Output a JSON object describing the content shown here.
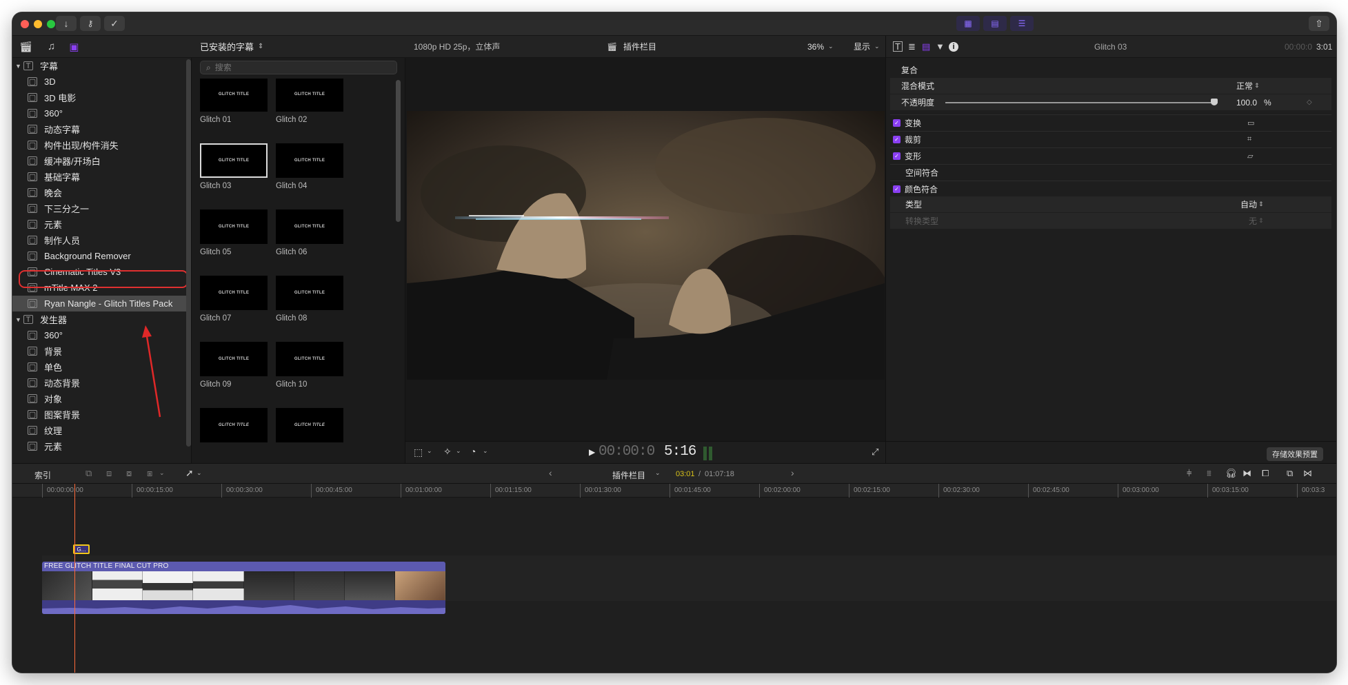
{
  "app": {
    "top_toolbar": {
      "import_icon": "arrow-down-icon",
      "keyword_icon": "key-icon",
      "check_icon": "checkmark-icon"
    }
  },
  "sidebar": {
    "groups": [
      {
        "label": "字幕",
        "items": [
          "3D",
          "3D 电影",
          "360°",
          "动态字幕",
          "构件出现/构件消失",
          "缓冲器/开场白",
          "基础字幕",
          "晚会",
          "下三分之一",
          "元素",
          "制作人员",
          "Background Remover",
          "Cinematic Titles V3",
          "mTitle MAX 2",
          "Ryan Nangle - Glitch Titles Pack"
        ]
      },
      {
        "label": "发生器",
        "items": [
          "360°",
          "背景",
          "单色",
          "动态背景",
          "对象",
          "图案背景",
          "纹理",
          "元素"
        ]
      }
    ],
    "selected": "Ryan Nangle - Glitch Titles Pack"
  },
  "browser": {
    "header": "已安装的字幕",
    "search_placeholder": "搜索",
    "thumb_caption": "GLITCH TITLE",
    "items": [
      "Glitch 01",
      "Glitch 02",
      "Glitch 03",
      "Glitch 04",
      "Glitch 05",
      "Glitch 06",
      "Glitch 07",
      "Glitch 08",
      "Glitch 09",
      "Glitch 10"
    ],
    "selected": "Glitch 03"
  },
  "viewer": {
    "format": "1080p HD 25p，立体声",
    "project": "插件栏目",
    "zoom": "36%",
    "display": "显示",
    "timecode_dim": "00:00:0",
    "timecode_bright": "5:16"
  },
  "inspector": {
    "title": "Glitch 03",
    "timecode_dim": "00:00:0",
    "timecode_bright": "3:01",
    "compositing": "复合",
    "blend_mode_label": "混合模式",
    "blend_mode_value": "正常",
    "opacity_label": "不透明度",
    "opacity_value": "100.0",
    "opacity_unit": "%",
    "opacity_fraction": 1.0,
    "transform": "变换",
    "crop": "裁剪",
    "distort": "变形",
    "spatial_conform": "空间符合",
    "color_conform": "颜色符合",
    "type_label": "类型",
    "type_value": "自动",
    "conversion_label": "转换类型",
    "conversion_value": "无",
    "save_preset": "存储效果预置"
  },
  "timeline": {
    "index": "索引",
    "project": "插件栏目",
    "position": "03:01",
    "duration": "01:07:18",
    "ruler": [
      "00:00:00:00",
      "00:00:15:00",
      "00:00:30:00",
      "00:00:45:00",
      "00:01:00:00",
      "00:01:15:00",
      "00:01:30:00",
      "00:01:45:00",
      "00:02:00:00",
      "00:02:15:00",
      "00:02:30:00",
      "00:02:45:00",
      "00:03:00:00",
      "00:03:15:00",
      "00:03:3"
    ],
    "clip_title": "FREE GLITCH TITLE  FINAL CUT PRO",
    "title_clip_label": "G..."
  },
  "colors": {
    "accent": "#8a3ff2",
    "clip": "#5c5ab0",
    "playhead": "#ff6a3a",
    "highlight": "#e03030",
    "timecode_yellow": "#d8c21a"
  }
}
